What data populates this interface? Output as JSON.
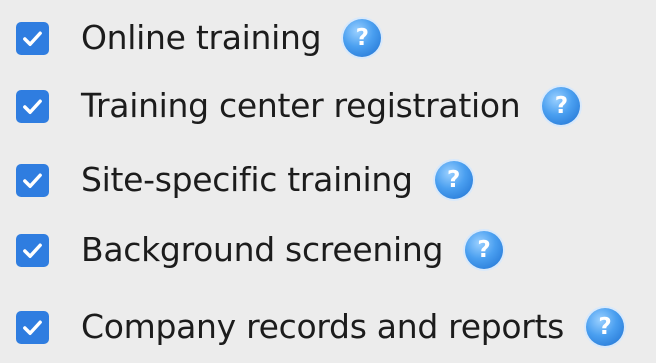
{
  "options": [
    {
      "label": "Online training",
      "checked": true,
      "help_icon": "question-mark-icon"
    },
    {
      "label": "Training center registration",
      "checked": true,
      "help_icon": "question-mark-icon"
    },
    {
      "label": "Site-specific training",
      "checked": true,
      "help_icon": "question-mark-icon"
    },
    {
      "label": "Background screening",
      "checked": true,
      "help_icon": "question-mark-icon"
    },
    {
      "label": "Company records and reports",
      "checked": true,
      "help_icon": "question-mark-icon"
    }
  ],
  "help_glyph": "?",
  "colors": {
    "background": "#ececec",
    "checkbox": "#2f7de0",
    "help_icon": "#4a9ff0",
    "text": "#1c1c1c"
  }
}
